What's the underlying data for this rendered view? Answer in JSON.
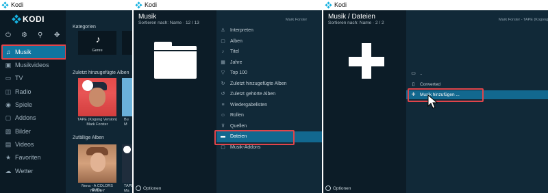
{
  "window1": {
    "title": "Kodi",
    "logo_text": "KODI",
    "top_icons": [
      "power-icon",
      "gear-icon",
      "search-icon",
      "move-icon"
    ],
    "menu": [
      {
        "label": "Musik",
        "icon": "headphones-icon",
        "active": true
      },
      {
        "label": "Musikvideos",
        "icon": "musicvideo-icon"
      },
      {
        "label": "TV",
        "icon": "tv-icon"
      },
      {
        "label": "Radio",
        "icon": "radio-icon"
      },
      {
        "label": "Spiele",
        "icon": "gamepad-icon"
      },
      {
        "label": "Addons",
        "icon": "addons-icon"
      },
      {
        "label": "Bilder",
        "icon": "image-icon"
      },
      {
        "label": "Videos",
        "icon": "film-icon"
      },
      {
        "label": "Favoriten",
        "icon": "star-icon"
      },
      {
        "label": "Wetter",
        "icon": "weather-icon"
      }
    ],
    "categories_title": "Kategorien",
    "genre_label": "Genre",
    "recent_title": "Zuletzt hinzugefügte Alben",
    "recent_albums": [
      {
        "title": "TAPE (Kogong Version)",
        "artist": "Mark Forster"
      },
      {
        "title": "Bu",
        "artist": "M"
      }
    ],
    "random_title": "Zufällige Alben",
    "random_albums": [
      {
        "title": "Nena - A COLORS SHO...",
        "artist": "YEVDEY"
      },
      {
        "title": "TAPE",
        "artist": "Ma"
      }
    ]
  },
  "window2": {
    "title": "Kodi",
    "heading": "Musik",
    "sort_text": "Sortieren nach: Name · 12 / 13",
    "right_header": "Mark Forster",
    "options": [
      {
        "label": "Interpreten",
        "icon": "microphone-icon"
      },
      {
        "label": "Alben",
        "icon": "album-icon"
      },
      {
        "label": "Titel",
        "icon": "note-icon"
      },
      {
        "label": "Jahre",
        "icon": "calendar-icon"
      },
      {
        "label": "Top 100",
        "icon": "trophy-icon"
      },
      {
        "label": "Zuletzt hinzugefügte Alben",
        "icon": "refresh-icon"
      },
      {
        "label": "Zuletzt gehörte Alben",
        "icon": "history-icon"
      },
      {
        "label": "Wiedergabelisten",
        "icon": "list-icon"
      },
      {
        "label": "Rollen",
        "icon": "person-icon"
      },
      {
        "label": "Quellen",
        "icon": "filter-icon"
      },
      {
        "label": "Dateien",
        "icon": "folder-icon",
        "active": true
      },
      {
        "label": "Musik-Addons",
        "icon": "addons-icon"
      }
    ],
    "options_label": "Optionen"
  },
  "window3": {
    "title": "Kodi",
    "heading": "Musik / Dateien",
    "sort_text": "Sortieren nach: Name · 2 / 2",
    "right_header": "Mark Forster - TAPE (Kogong Version)",
    "items": [
      {
        "label": "..",
        "icon": "folder-up-icon"
      },
      {
        "label": "Converted",
        "icon": "phone-icon"
      },
      {
        "label": "Musik hinzufügen ...",
        "icon": "plus-icon",
        "active": true
      }
    ],
    "options_label": "Optionen"
  },
  "colors": {
    "accent": "#12688f",
    "highlight_box": "#e0454b",
    "kodi_blue": "#17b2e0",
    "background": "#0f2230"
  }
}
